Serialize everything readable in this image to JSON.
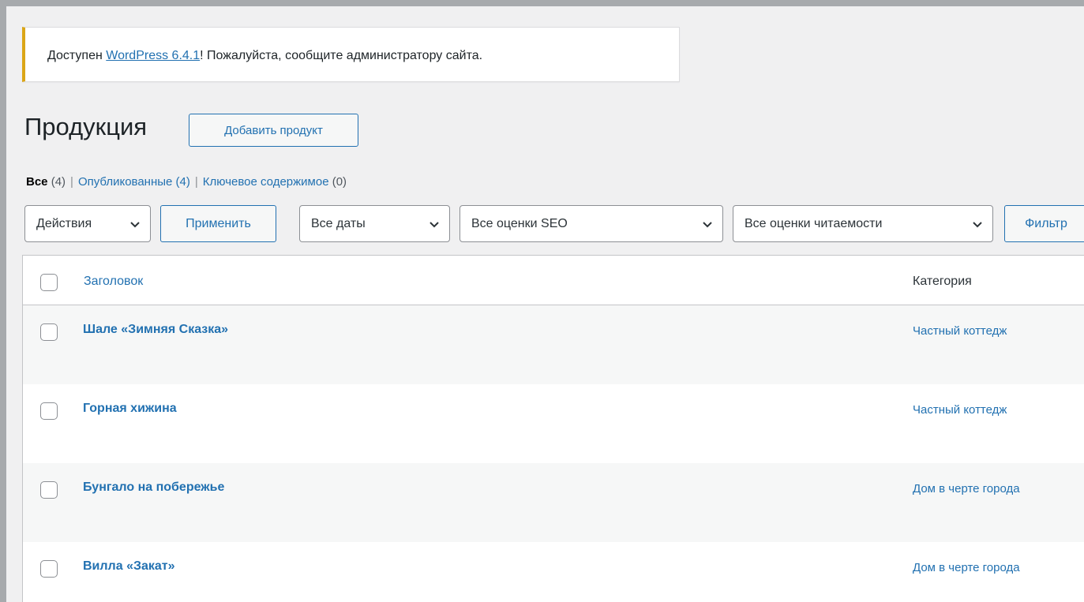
{
  "notice": {
    "prefix": "Доступен ",
    "link": "WordPress 6.4.1",
    "suffix": "! Пожалуйста, сообщите администратору сайта."
  },
  "page": {
    "title": "Продукция",
    "add_button": "Добавить продукт"
  },
  "views": [
    {
      "label": "Все",
      "count": "(4)"
    },
    {
      "label": "Опубликованные",
      "count": "(4)"
    },
    {
      "label": "Ключевое содержимое",
      "count": "(0)"
    }
  ],
  "views_sep": "|",
  "filters": {
    "bulk_actions": "Действия",
    "apply": "Применить",
    "dates": "Все даты",
    "seo": "Все оценки SEO",
    "readability": "Все оценки читаемости",
    "filter": "Фильтр"
  },
  "table": {
    "columns": {
      "title": "Заголовок",
      "category": "Категория"
    },
    "rows": [
      {
        "title": "Шале «Зимняя Сказка»",
        "category": "Частный коттедж"
      },
      {
        "title": "Горная хижина",
        "category": "Частный коттедж"
      },
      {
        "title": "Бунгало на побережье",
        "category": "Дом в черте города"
      },
      {
        "title": "Вилла «Закат»",
        "category": "Дом в черте города"
      }
    ]
  },
  "icons": {
    "dropdown": "chevron-down-icon"
  },
  "colors": {
    "link": "#2271b1",
    "notice_accent": "#dba617",
    "background": "#f0f0f1"
  }
}
